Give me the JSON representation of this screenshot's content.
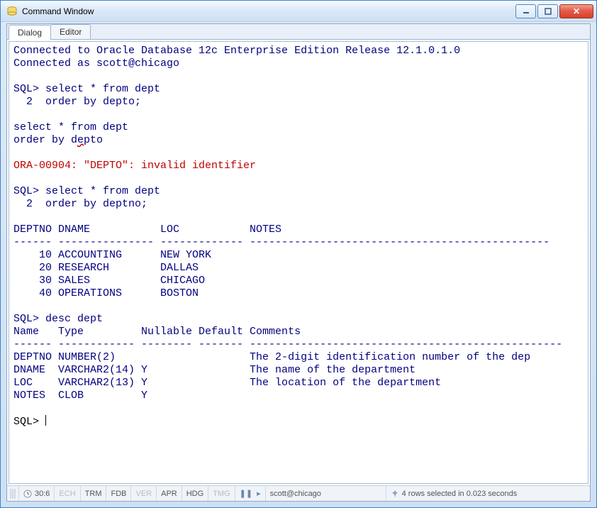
{
  "window": {
    "title": "Command Window"
  },
  "tabs": {
    "dialog": "Dialog",
    "editor": "Editor"
  },
  "console": {
    "conn1": "Connected to Oracle Database 12c Enterprise Edition Release 12.1.0.1.0",
    "conn2": "Connected as scott@chicago",
    "p1l1": "SQL> select * from dept",
    "p1l2": "  2  order by depto;",
    "echo1": "select * from dept",
    "echo2_pre": "order by d",
    "echo2_err": "e",
    "echo2_post": "pto",
    "error": "ORA-00904: \"DEPTO\": invalid identifier",
    "p2l1": "SQL> select * from dept",
    "p2l2": "  2  order by deptno;",
    "hdr": "DEPTNO DNAME           LOC           NOTES",
    "rule": "------ --------------- ------------- -----------------------------------------------",
    "r1": "    10 ACCOUNTING      NEW YORK      ",
    "r2": "    20 RESEARCH        DALLAS        ",
    "r3": "    30 SALES           CHICAGO       ",
    "r4": "    40 OPERATIONS      BOSTON        ",
    "p3": "SQL> desc dept",
    "dhdr": "Name   Type         Nullable Default Comments",
    "drule": "------ ------------ -------- ------- -------------------------------------------------",
    "d1": "DEPTNO NUMBER(2)                     The 2-digit identification number of the dep",
    "d2": "DNAME  VARCHAR2(14) Y                The name of the department",
    "d3": "LOC    VARCHAR2(13) Y                The location of the department",
    "d4": "NOTES  CLOB         Y                ",
    "prompt": "SQL> "
  },
  "status": {
    "pos": "30:6",
    "ind": {
      "ech": "ECH",
      "trm": "TRM",
      "fdb": "FDB",
      "ver": "VER",
      "apr": "APR",
      "hdg": "HDG",
      "tmg": "TMG"
    },
    "conn": "scott@chicago",
    "rows": "4 rows selected in 0.023 seconds"
  }
}
